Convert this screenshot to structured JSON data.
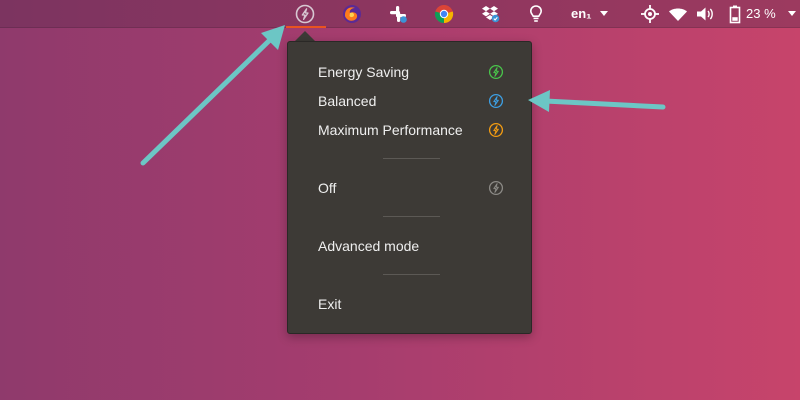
{
  "topbar": {
    "language": "en₁",
    "battery_percent": "23 %",
    "icons": [
      "power-mode-icon",
      "firefox-icon",
      "slack-icon",
      "chrome-icon",
      "dropbox-icon",
      "lightbulb-icon",
      "crosshair-icon",
      "wifi-icon",
      "volume-icon",
      "battery-icon"
    ]
  },
  "menu": {
    "items": [
      {
        "label": "Energy Saving",
        "icon": "power-green-icon",
        "color": "#49c54b"
      },
      {
        "label": "Balanced",
        "icon": "power-blue-icon",
        "color": "#3d9fe3"
      },
      {
        "label": "Maximum Performance",
        "icon": "power-orange-icon",
        "color": "#f39c12"
      },
      {
        "label": "Off",
        "icon": "power-gray-icon",
        "color": "#8c8a86"
      },
      {
        "label": "Advanced mode"
      },
      {
        "label": "Exit"
      }
    ]
  },
  "colors": {
    "menu_bg": "#3d3a36",
    "arrow": "#6cc6c5",
    "accent": "#e95420"
  }
}
